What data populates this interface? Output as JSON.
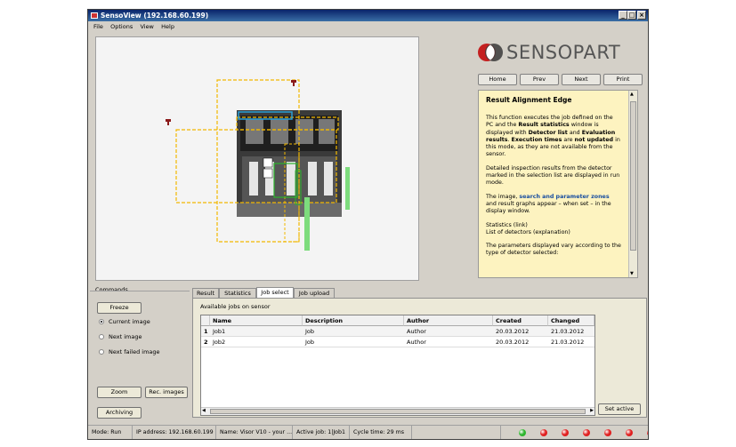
{
  "window": {
    "title": "SensoView (192.168.60.199)"
  },
  "menu": [
    "File",
    "Options",
    "View",
    "Help"
  ],
  "logo": {
    "text": "SENSOPART"
  },
  "nav": {
    "home": "Home",
    "prev": "Prev",
    "next": "Next",
    "print": "Print"
  },
  "help": {
    "title": "Result Alignment Edge",
    "p1_a": "This function executes the job defined on the PC and the ",
    "p1_b": "Result statistics",
    "p1_c": " window is displayed with ",
    "p1_d": "Detector list",
    "p1_e": " and ",
    "p1_f": "Evaluation results",
    "p1_g": ". ",
    "p1_h": "Execution times",
    "p1_i": " are ",
    "p1_j": "not updated",
    "p1_k": " in this mode, as they are not available from the sensor.",
    "p2": "Detailed inspection results from the detector marked in the selection list are displayed in run mode.",
    "p3_a": "The image, ",
    "p3_link": "search and parameter zones",
    "p3_b": " and result graphs appear – when set – in the display window.",
    "p4_a": "Statistics (link)",
    "p4_b": "List of detectors (explanation)",
    "p5": "The parameters displayed vary according to the type of detector selected:"
  },
  "commands": {
    "label": "Commands",
    "freeze": "Freeze",
    "radios": [
      "Current image",
      "Next image",
      "Next failed image"
    ],
    "selected_radio": "Current image",
    "zoom": "Zoom",
    "rec_images": "Rec. images",
    "archiving": "Archiving"
  },
  "tabs": [
    "Result",
    "Statistics",
    "Job select",
    "Job upload"
  ],
  "active_tab": "Job select",
  "jobs": {
    "caption": "Available jobs on sensor",
    "columns": [
      "Name",
      "Description",
      "Author",
      "Created",
      "Changed"
    ],
    "rows": [
      {
        "num": "1",
        "name": "Job1",
        "description": "Job",
        "author": "Author",
        "created": "20.03.2012",
        "changed": "21.03.2012"
      },
      {
        "num": "2",
        "name": "Job2",
        "description": "Job",
        "author": "Author",
        "created": "20.03.2012",
        "changed": "21.03.2012"
      }
    ],
    "set_active": "Set active"
  },
  "status": {
    "mode": "Mode:  Run",
    "ip": "IP address:  192.168.60.199",
    "name": "Name:  Visor V10 - your ...",
    "job": "Active job:  1|Job1",
    "cycle": "Cycle time:  29 ms"
  },
  "leds": [
    "#2db52d",
    "#e02020",
    "#e02020",
    "#e02020",
    "#e02020",
    "#e02020",
    "#e02020"
  ]
}
